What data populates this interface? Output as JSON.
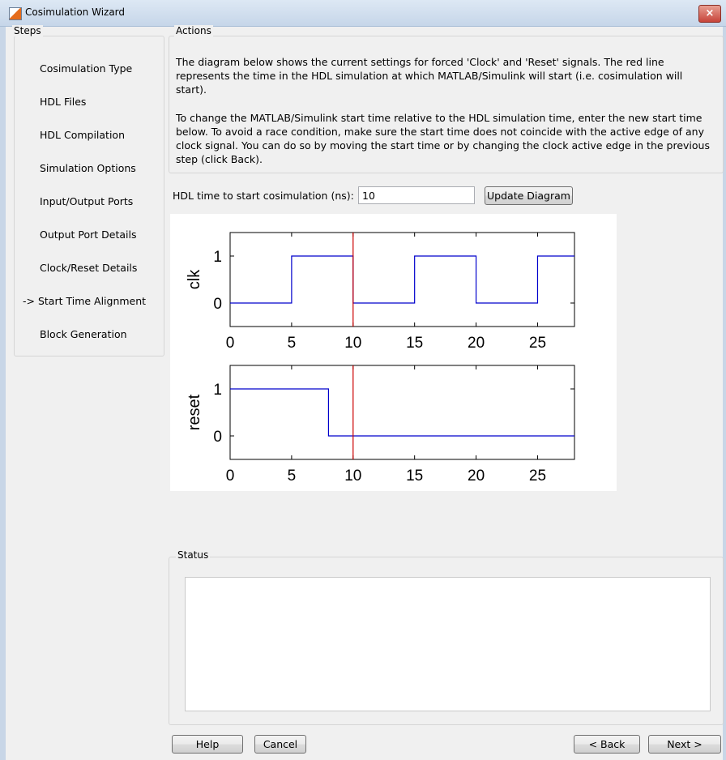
{
  "window": {
    "title": "Cosimulation Wizard",
    "close_glyph": "×"
  },
  "steps": {
    "title": "Steps",
    "current_marker": "->",
    "items": [
      "Cosimulation Type",
      "HDL Files",
      "HDL Compilation",
      "Simulation Options",
      "Input/Output Ports",
      "Output Port Details",
      "Clock/Reset Details",
      "Start Time Alignment",
      "Block Generation"
    ],
    "current_index": 7
  },
  "actions": {
    "title": "Actions",
    "para1_line1": "The diagram below shows the current settings for forced 'Clock' and 'Reset' signals. The red line",
    "para1_line2": "represents the time in the HDL simulation at which MATLAB/Simulink will start (i.e. cosimulation will",
    "para1_line3": "start).",
    "para2_line1": "To change the MATLAB/Simulink start time relative to the HDL simulation time, enter the new start time",
    "para2_line2": "below. To avoid a race condition, make sure the start time does not coincide with the active edge of any",
    "para2_line3": "clock signal. You can do so by moving the start time or by changing the clock active edge in the previous",
    "para2_line4": "step (click Back)."
  },
  "start_time": {
    "label": "HDL time to start cosimulation (ns):",
    "value": "10",
    "update_button": "Update Diagram"
  },
  "chart_data": [
    {
      "type": "line",
      "step": true,
      "ylabel": "clk",
      "xlim": [
        0,
        28
      ],
      "ylim": [
        -0.5,
        1.5
      ],
      "xticks": [
        0,
        5,
        10,
        15,
        20,
        25
      ],
      "yticks": [
        0,
        1
      ],
      "x": [
        0,
        5,
        5,
        10,
        10,
        15,
        15,
        20,
        20,
        25,
        25,
        28
      ],
      "y": [
        0,
        0,
        1,
        1,
        0,
        0,
        1,
        1,
        0,
        0,
        1,
        1
      ],
      "series_color": "#0000cc",
      "marker_line": {
        "x": 10,
        "color": "#cc0000"
      }
    },
    {
      "type": "line",
      "step": true,
      "ylabel": "reset",
      "xlim": [
        0,
        28
      ],
      "ylim": [
        -0.5,
        1.5
      ],
      "xticks": [
        0,
        5,
        10,
        15,
        20,
        25
      ],
      "yticks": [
        0,
        1
      ],
      "x": [
        0,
        8,
        8,
        28
      ],
      "y": [
        1,
        1,
        0,
        0
      ],
      "series_color": "#0000cc",
      "marker_line": {
        "x": 10,
        "color": "#cc0000"
      }
    }
  ],
  "status": {
    "title": "Status",
    "text": ""
  },
  "footer": {
    "help": "Help",
    "cancel": "Cancel",
    "back": "< Back",
    "next": "Next >"
  }
}
